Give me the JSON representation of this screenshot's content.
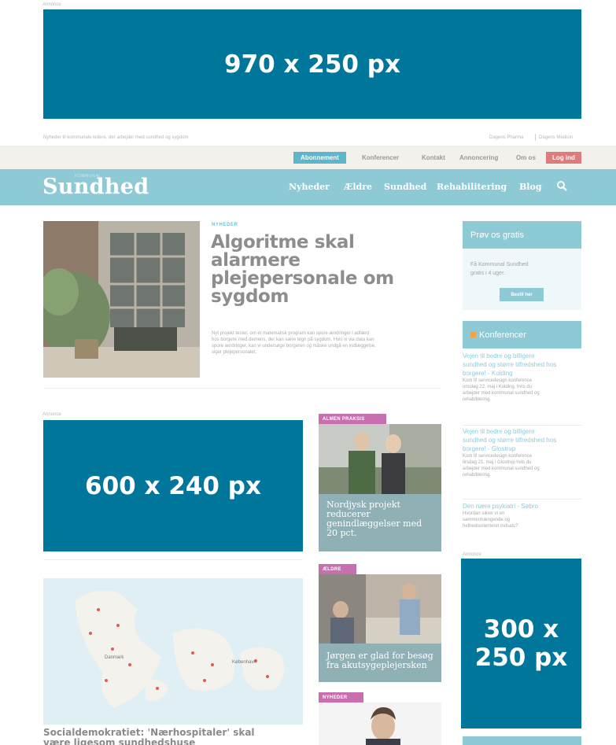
{
  "ads": {
    "label": "Annonce",
    "top_banner": "970 x 250 px",
    "mid_banner": "600 x 240 px",
    "side_banner": "300 x 250 px"
  },
  "utility": {
    "tagline": "Nyheder til kommunale ledere, der arbejder med sundhed og sygdom",
    "links": [
      "Dagens Pharma",
      "Dagens Medicin"
    ]
  },
  "top_menu": {
    "subscribe": "Abonnement",
    "items": [
      "Konferencer",
      "Kontakt",
      "Annoncering",
      "Om os"
    ],
    "login": "Log ind"
  },
  "brand": {
    "kicker": "KOMMUNAL",
    "name": "Sundhed"
  },
  "nav": {
    "items": [
      "Nyheder",
      "Ældre",
      "Sundhed",
      "Rehabilitering",
      "Blog"
    ]
  },
  "hero": {
    "kicker": "NYHEDER",
    "title_lines": [
      "Algoritme skal",
      "alarmere",
      "plejepersonale om",
      "sygdom"
    ],
    "summary_lines": [
      "Nyt projekt tester, om et matematisk program kan spore ændringer i adfærd",
      "hos borgere med demens, der kan være tegn på sygdom. Hvis vi via data kan",
      "spore ændringer, kan vi undersøge borgeren og måske undgå en indlæggelse,",
      "siger plejepersonalet."
    ]
  },
  "sidebar": {
    "trial": {
      "title": "Prøv os gratis",
      "text_lines": [
        "Få Kommunal Sundhed",
        "gratis i 4 uger."
      ],
      "button": "Bestil her"
    },
    "conferences": {
      "title": "Konferencer",
      "items": [
        {
          "title_lines": [
            "Vejen til bedre og billigere",
            "sundhed og større tilfredshed hos",
            "borgere! - Kolding"
          ],
          "desc_lines": [
            "Kom til servicedesign konference",
            "onsdag 22. maj i Kolding, hvis du",
            "arbejder med kommunal sundhed og",
            "rehabilitering."
          ]
        },
        {
          "title_lines": [
            "Vejen til bedre og billigere",
            "sundhed og større tilfredshed hos",
            "borgere! - Glostrup"
          ],
          "desc_lines": [
            "Kom til servicedesign konference",
            "tirsdag 21. maj i Glostrup hvis du",
            "arbejder med kommunal sundhed og",
            "rehabilitering."
          ]
        },
        {
          "title_lines": [
            "Den nære psykiatri - Søbro"
          ],
          "desc_lines": [
            "Hvordan sikrer vi en",
            "sammenhængende og",
            "helhedsorienteret indsats?"
          ]
        }
      ]
    }
  },
  "cards": [
    {
      "tag": "ALMEN PRAKSIS",
      "caption_lines": [
        "Nordjysk projekt",
        "reducerer",
        "genindlæggelser med",
        "20 pct."
      ]
    },
    {
      "tag": "ÆLDRE",
      "caption_lines": [
        "Jørgen er glad for besøg",
        "fra akutsygeplejersken"
      ]
    },
    {
      "tag": "NYHEDER",
      "caption_lines": []
    }
  ],
  "map_story": {
    "title_lines": [
      "Socialdemokratiet: 'Nærhospitaler' skal",
      "være ligesom sundhedshuse"
    ],
    "places": [
      "Danmark",
      "København"
    ]
  },
  "colors": {
    "ad_blue": "#00769a",
    "brand_teal": "#8ec9d6",
    "login_red": "#e07b7b",
    "tag_pink": "#c86fb0",
    "subscribe_teal": "#5db6c9"
  }
}
